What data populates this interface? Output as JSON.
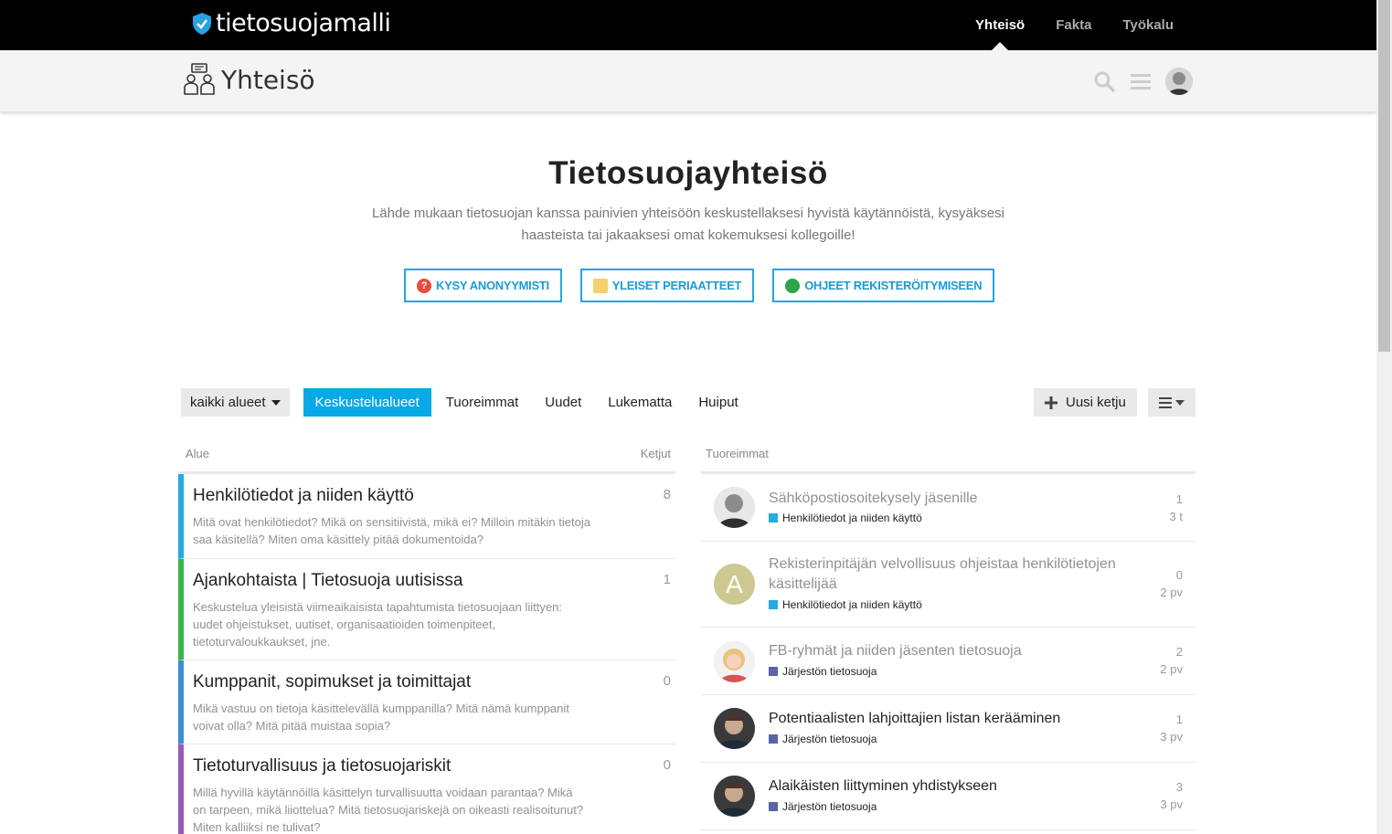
{
  "brand": {
    "name": "tietosuojamalli"
  },
  "topnav": [
    "Yhteisö",
    "Fakta",
    "Työkalu"
  ],
  "subheader": {
    "title": "Yhteisö"
  },
  "hero": {
    "title": "Tietosuojayhteisö",
    "description": "Lähde mukaan tietosuojan kanssa painivien yhteisöön keskustellaksesi hyvistä käytännöistä, kysyäksesi haasteista tai jakaaksesi omat kokemuksesi kollegoille!",
    "buttons": [
      "KYSY ANONYYMISTI",
      "YLEISET PERIAATTEET",
      "OHJEET REKISTERÖITYMISEEN"
    ]
  },
  "nav": {
    "dropdown": "kaikki alueet",
    "tabs": [
      "Keskustelualueet",
      "Tuoreimmat",
      "Uudet",
      "Lukematta",
      "Huiput"
    ],
    "new_topic": "Uusi ketju"
  },
  "categories": {
    "header_area": "Alue",
    "header_topics": "Ketjut",
    "rows": [
      {
        "title": "Henkilötiedot ja niiden käyttö",
        "count": "8",
        "color": "#25AAE1",
        "desc": "Mitä ovat henkilötiedot? Mikä on sensitiivistä, mikä ei? Milloin mitäkin tietoja saa käsitellä? Miten oma käsittely pitää dokumentoida?"
      },
      {
        "title": "Ajankohtaista | Tietosuoja uutisissa",
        "count": "1",
        "color": "#3AB54A",
        "desc": "Keskustelua yleisistä viimeaikaisista tapahtumista tietosuojaan liittyen: uudet ohjeistukset, uutiset, organisaatioiden toimenpiteet, tietoturvaloukkaukset, jne."
      },
      {
        "title": "Kumppanit, sopimukset ja toimittajat",
        "count": "0",
        "color": "#3D8FD5",
        "desc": "Mikä vastuu on tietoja käsittelevällä kumppanilla? Mitä nämä kumppanit voivat olla? Mitä pitää muistaa sopia?"
      },
      {
        "title": "Tietoturvallisuus ja tietosuojariskit",
        "count": "0",
        "color": "#9B59B6",
        "desc": "Millä hyvillä käytännöillä käsittelyn turvallisuutta voidaan parantaa? Mikä on tarpeen, mikä liiottelua? Mitä tietosuojariskejä on oikeasti realisoitunut? Miten kalliiksi ne tulivat?"
      }
    ]
  },
  "latest": {
    "header": "Tuoreimmat",
    "rows": [
      {
        "title": "Sähköpostiosoitekysely jäsenille",
        "category": "Henkilötiedot ja niiden käyttö",
        "cat_color": "#25AAE1",
        "replies": "1",
        "age": "3 t",
        "unread": false,
        "avatar_letter": ""
      },
      {
        "title": "Rekisterinpitäjän velvollisuus ohjeistaa henkilötietojen käsittelijää",
        "category": "Henkilötiedot ja niiden käyttö",
        "cat_color": "#25AAE1",
        "replies": "0",
        "age": "2 pv",
        "unread": false,
        "avatar_letter": "A"
      },
      {
        "title": "FB-ryhmät ja niiden jäsenten tietosuoja",
        "category": "Järjestön tietosuoja",
        "cat_color": "#5A63A8",
        "replies": "2",
        "age": "2 pv",
        "unread": false,
        "avatar_letter": ""
      },
      {
        "title": "Potentiaalisten lahjoittajien listan kerääminen",
        "category": "Järjestön tietosuoja",
        "cat_color": "#5A63A8",
        "replies": "1",
        "age": "3 pv",
        "unread": true,
        "avatar_letter": ""
      },
      {
        "title": "Alaikäisten liittyminen yhdistykseen",
        "category": "Järjestön tietosuoja",
        "cat_color": "#5A63A8",
        "replies": "3",
        "age": "3 pv",
        "unread": true,
        "avatar_letter": ""
      }
    ]
  }
}
